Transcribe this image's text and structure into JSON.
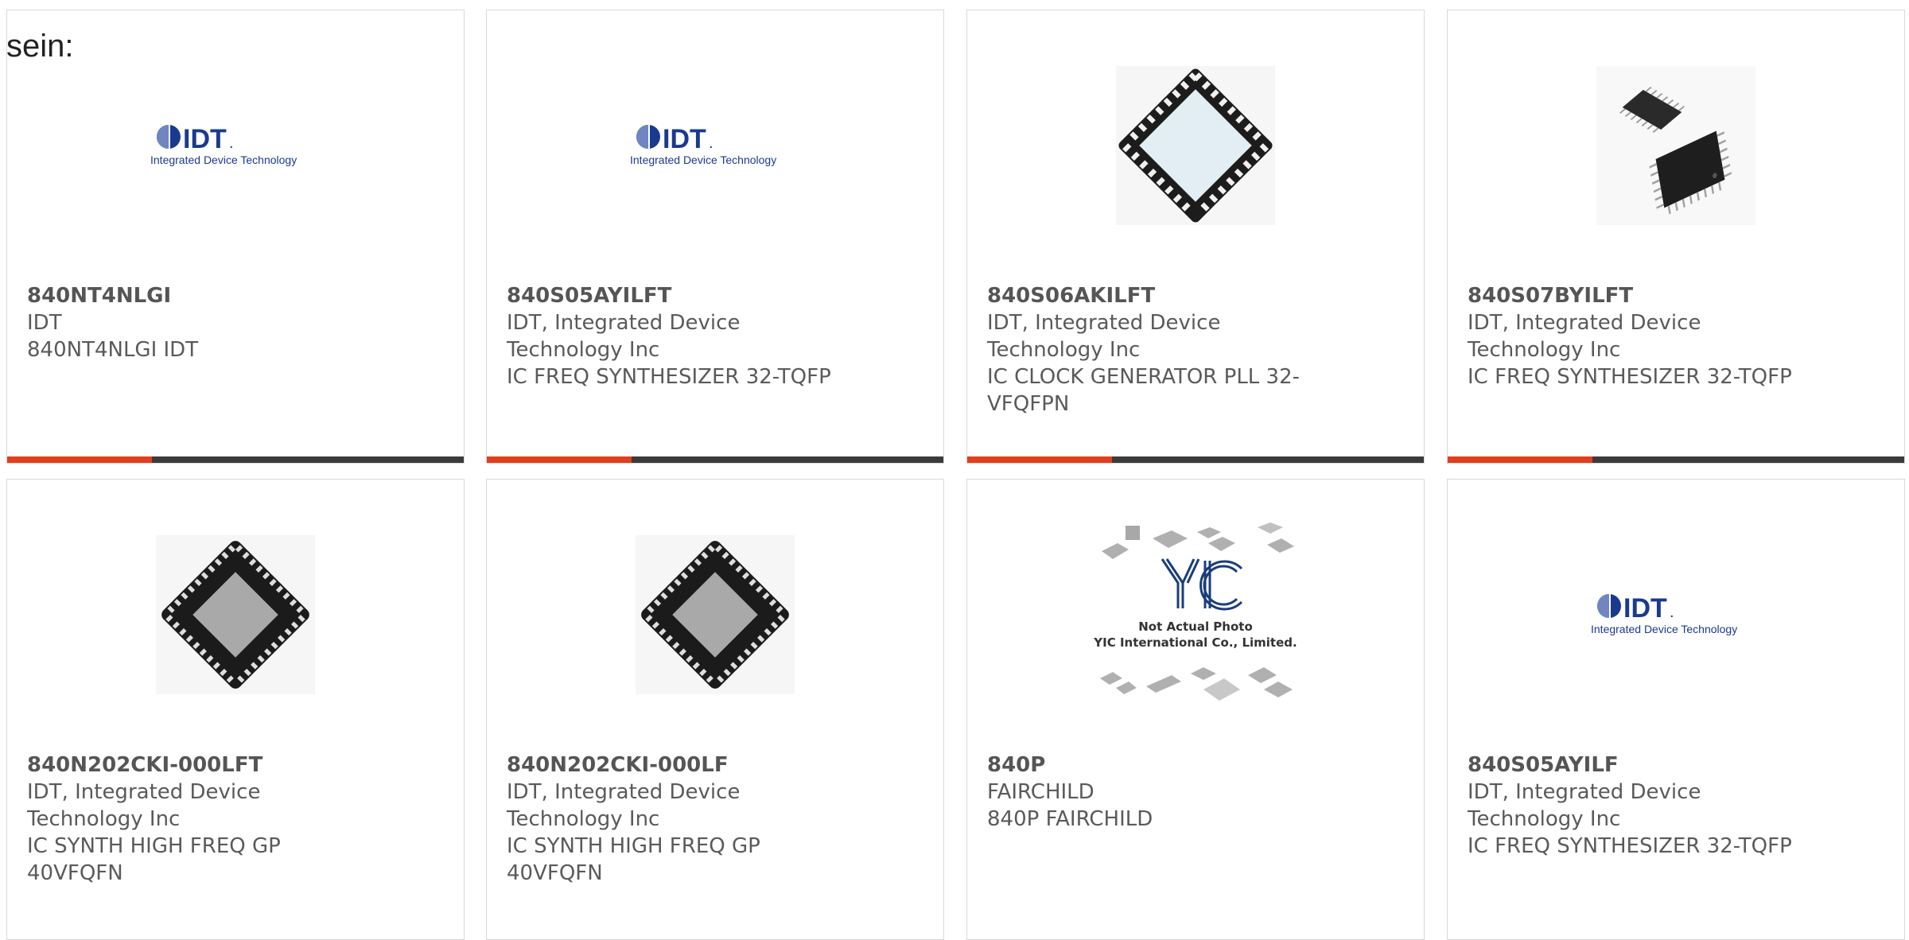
{
  "intro_text": "sein:",
  "colors": {
    "accent": "#e0401a",
    "bar_dark": "#3b3b3b",
    "idt_blue": "#1a3a8f"
  },
  "logo": {
    "idt_wordmark": "IDT",
    "idt_trademark": ".",
    "idt_tagline": "Integrated Device Technology"
  },
  "yic_placeholder": {
    "logo_text": "YIC",
    "caption_line1": "Not Actual Photo",
    "caption_line2": "YIC International Co., Limited."
  },
  "products": [
    {
      "part_number": "840NT4NLGI",
      "line1": "IDT",
      "line2": "840NT4NLGI IDT",
      "line3": "",
      "line4": "",
      "image": "idt-logo"
    },
    {
      "part_number": "840S05AYILFT",
      "line1": "IDT, Integrated Device",
      "line2": "Technology Inc",
      "line3": "IC FREQ SYNTHESIZER 32-TQFP",
      "line4": "",
      "image": "idt-logo"
    },
    {
      "part_number": "840S06AKILFT",
      "line1": "IDT, Integrated Device",
      "line2": "Technology Inc",
      "line3": "IC CLOCK GENERATOR PLL 32-",
      "line4": "VFQFPN",
      "image": "qfn-chip"
    },
    {
      "part_number": "840S07BYILFT",
      "line1": "IDT, Integrated Device",
      "line2": "Technology Inc",
      "line3": "IC FREQ SYNTHESIZER 32-TQFP",
      "line4": "",
      "image": "tqfp-chips"
    },
    {
      "part_number": "840N202CKI-000LFT",
      "line1": "IDT, Integrated Device",
      "line2": "Technology Inc",
      "line3": "IC SYNTH HIGH FREQ GP",
      "line4": "40VFQFN",
      "image": "vfqfn-chip"
    },
    {
      "part_number": "840N202CKI-000LF",
      "line1": "IDT, Integrated Device",
      "line2": "Technology Inc",
      "line3": "IC SYNTH HIGH FREQ GP",
      "line4": "40VFQFN",
      "image": "vfqfn-chip"
    },
    {
      "part_number": "840P",
      "line1": "FAIRCHILD",
      "line2": "840P FAIRCHILD",
      "line3": "",
      "line4": "",
      "image": "yic-placeholder"
    },
    {
      "part_number": "840S05AYILF",
      "line1": "IDT, Integrated Device",
      "line2": "Technology Inc",
      "line3": "IC FREQ SYNTHESIZER 32-TQFP",
      "line4": "",
      "image": "idt-logo"
    }
  ]
}
